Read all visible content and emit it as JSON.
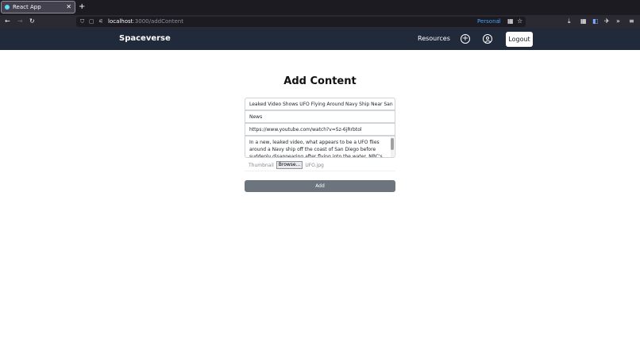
{
  "browser": {
    "tab_title": "React App",
    "url_host": "localhost",
    "url_path": ":3000/addContent",
    "container_label": "Personal"
  },
  "app": {
    "brand": "Spaceverse",
    "nav_resources": "Resources",
    "logout_label": "Logout"
  },
  "form": {
    "title": "Add Content",
    "title_value": "Leaked Video Shows UFO Flying Around Navy Ship Near San Diego.",
    "category_value": "News",
    "link_value": "https://www.youtube.com/watch?v=Sz-6jRrbtol",
    "description_value": "In a new, leaked video, what appears to be a UFO flies around a Navy ship off the coast of San Diego before suddenly disappearing after flying into the water. NBC's Gadi Schwartz reports for",
    "thumbnail_label": "Thumbnail",
    "browse_label": "Browse...",
    "file_name": "UFO.jpg",
    "submit_label": "Add"
  }
}
